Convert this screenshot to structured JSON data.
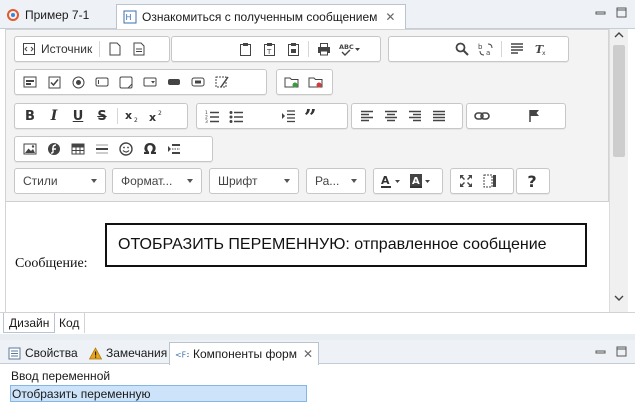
{
  "editor_tabs": [
    {
      "label": "Пример 7-1"
    },
    {
      "label": "Ознакомиться с полученным сообщением"
    }
  ],
  "toolbar": {
    "source_label": "Источник",
    "styles_label": "Стили",
    "format_label": "Формат...",
    "font_label": "Шрифт",
    "size_label": "Ра..."
  },
  "content": {
    "message_label": "Сообщение:",
    "display_box_text": "ОТОБРАЗИТЬ ПЕРЕМЕННУЮ: отправленное сообщение"
  },
  "mode_tabs": {
    "design": "Дизайн",
    "code": "Код"
  },
  "panel_tabs": [
    {
      "label": "Свойства"
    },
    {
      "label": "Замечания"
    },
    {
      "label": "Компоненты форм"
    }
  ],
  "components": [
    {
      "label": "Ввод переменной"
    },
    {
      "label": "Отобразить переменную"
    }
  ],
  "colors": {
    "selection": "#cde3fa",
    "tab_active": "#ffffff",
    "warning": "#e8a317"
  }
}
